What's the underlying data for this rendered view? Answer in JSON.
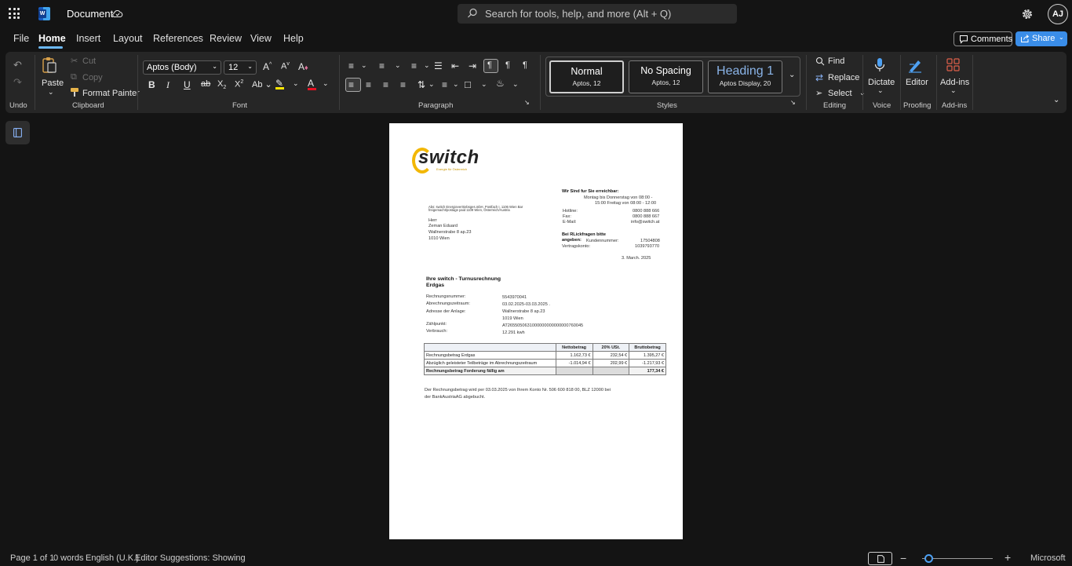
{
  "titlebar": {
    "doc_title": "Document",
    "search_placeholder": "Search for tools, help, and more (Alt + Q)",
    "avatar_initials": "AJ"
  },
  "menu": {
    "items": [
      "File",
      "Home",
      "Insert",
      "Layout",
      "References",
      "Review",
      "View",
      "Help"
    ],
    "active": "Home",
    "comments_label": "Comments",
    "share_label": "Share"
  },
  "ribbon": {
    "undo_group_label": "Undo",
    "clipboard": {
      "paste": "Paste",
      "cut": "Cut",
      "copy": "Copy",
      "format_painter": "Format Painter",
      "label": "Clipboard"
    },
    "font": {
      "font_name": "Aptos (Body)",
      "font_size": "12",
      "label": "Font"
    },
    "paragraph_label": "Paragraph",
    "styles": {
      "label": "Styles",
      "cards": [
        {
          "name": "Normal",
          "sub": "Aptos, 12"
        },
        {
          "name": "No Spacing",
          "sub": "Aptos, 12"
        },
        {
          "name": "Heading 1",
          "sub": "Aptos Display, 20"
        }
      ]
    },
    "editing": {
      "find": "Find",
      "replace": "Replace",
      "select": "Select",
      "label": "Editing"
    },
    "voice": {
      "dictate": "Dictate",
      "label": "Voice"
    },
    "proofing": {
      "editor": "Editor",
      "label": "Proofing"
    },
    "addins": {
      "addins": "Add-ins",
      "label": "Add-ins"
    }
  },
  "document": {
    "logo_word": "switch",
    "logo_tagline": "Energie für Österreich",
    "contact": {
      "heading": "Wir Sind fur Sie erreichbar:",
      "hours_1": "Montag bis Donnerstag von 08:00 -",
      "hours_2": "15:00 Freitag von 08:00 - 12:00",
      "hotline_label": "Hotline:",
      "hotline": "0800 888 666",
      "fax_label": "Fax:",
      "fax": "0800 888 667",
      "email_label": "E-Mail:",
      "email": "info@switch.at",
      "queries_heading_1": "Bei RLickfragen bitte",
      "queries_heading_2": "angeben:",
      "customer_no_label": "Kundennummer:",
      "customer_no": "17504808",
      "contract_label": "Vertragskonto:",
      "contract": "1039793770",
      "date": "3. March. 2025"
    },
    "sender_line_1": "Abs: switch Energievertriebsges.mbH, Postfach I, 1106 Wien Bar",
    "sender_line_2": "freigemacht/postage paid 1109 Wien, Österreich/Austria",
    "recipient": {
      "salutation": "Herr",
      "name": "Zeman Eduard",
      "street": "Wallnerstrabe 8 ap.23",
      "city": "1010 Wien"
    },
    "invoice_title": "Ihre switch - Turnusrechnung",
    "invoice_subtitle": "Erdgas",
    "details": {
      "number_label": "Rechnungsnummer:",
      "number": "5543970041",
      "period_label": "Abrechnungszeitraum:",
      "period": "03.02.2025-03.03.2025 .",
      "address_label": "Adresse der Anlage:",
      "address_1": "Wallnerstrabe 8 ap.23",
      "address_2": "1019 Wien",
      "meter_label": "Zählpunkt:",
      "meter": "AT2655050631000000000000000760045",
      "usage_label": "Verbrauch:",
      "usage": "12.291 kwh"
    },
    "table": {
      "headers": [
        "",
        "Nettobetrag",
        "20% USt.",
        "Bruttobetrag"
      ],
      "rows": [
        [
          "Rechnungsbetrag Erdgas",
          "1.162,73 €",
          "232,54 €",
          "1.395,27 €"
        ],
        [
          "Abzüglich geleisteter Teilbeträge im Abrechnungszeitraum",
          "-1.014,94 €",
          "202,99 €",
          "-1.217,93 €"
        ],
        [
          "Rechnungsbetrag Forderung fällig am",
          "",
          "",
          "177,34 €"
        ]
      ]
    },
    "footer_1": "Der Rechnungsbetrag wird per 03.03.2025 von Ihrem Konto Nr. 506 600 818 00, BLZ 12000 bei",
    "footer_2": "der BankAustriaAG abgebucht."
  },
  "status": {
    "page": "Page 1 of 1",
    "words": "0 words",
    "language": "English (U.K.)",
    "editor": "Editor Suggestions: Showing",
    "vendor": "Microsoft"
  }
}
